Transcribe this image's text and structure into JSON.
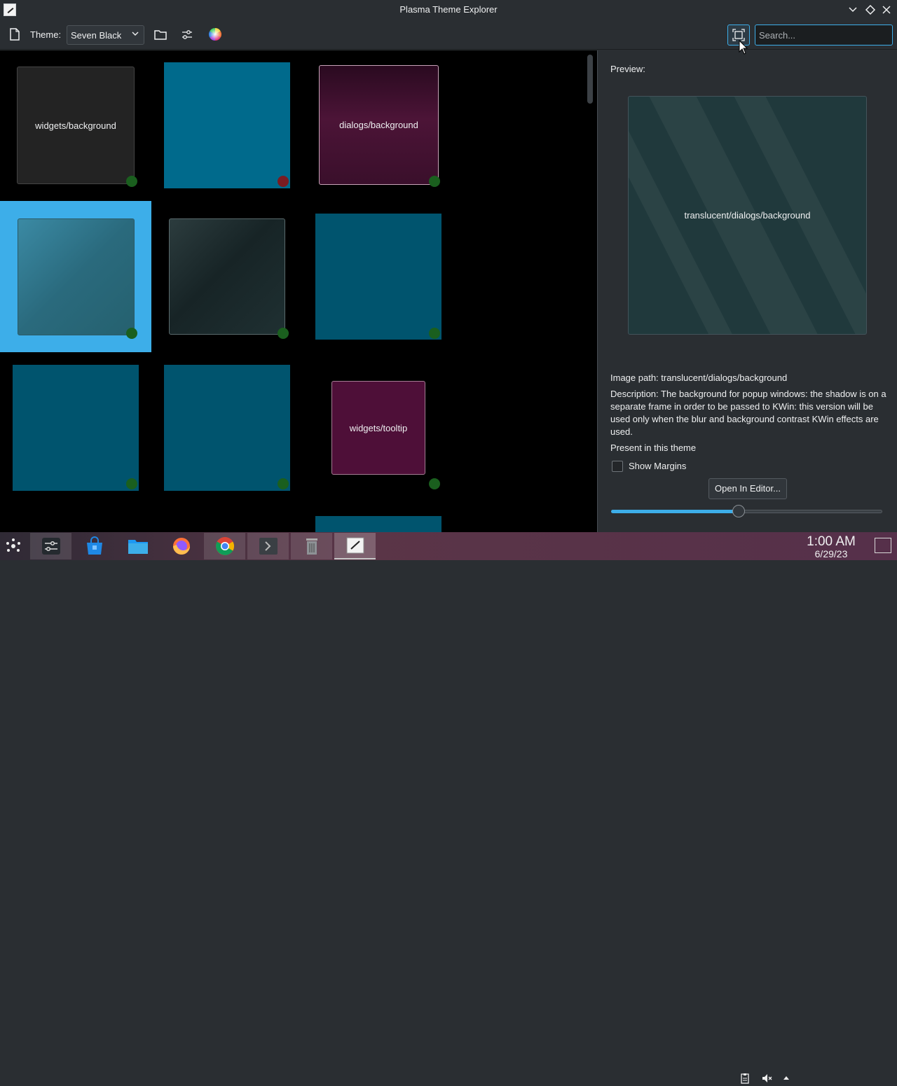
{
  "window": {
    "title": "Plasma Theme Explorer",
    "controls": [
      "minimize-icon",
      "maximize-icon",
      "close-icon"
    ]
  },
  "toolbar": {
    "theme_label": "Theme:",
    "theme_value": "Seven Black",
    "search_placeholder": "Search..."
  },
  "grid": {
    "tiles": [
      {
        "label": "widgets/background",
        "color": "#232323",
        "status": "present"
      },
      {
        "label": "",
        "color": "#006a8c",
        "status": "missing"
      },
      {
        "label": "dialogs/background",
        "color": "#3a0f2b",
        "status": "present"
      },
      {
        "label": "",
        "color": "#2a6a7d",
        "status": "present",
        "selected": true
      },
      {
        "label": "",
        "color": "#1c2c2e",
        "status": "present"
      },
      {
        "label": "",
        "color": "#00546e",
        "status": "present"
      },
      {
        "label": "",
        "color": "#00546e",
        "status": "present"
      },
      {
        "label": "",
        "color": "#00546e",
        "status": "present"
      },
      {
        "label": "widgets/tooltip",
        "color": "#4e0f38",
        "status": "present"
      }
    ]
  },
  "preview": {
    "heading": "Preview:",
    "element_name": "translucent/dialogs/background",
    "image_path_line": "Image path: translucent/dialogs/background",
    "description_line": "Description: The background for popup windows: the shadow is on a separate frame in order to be passed to KWin: this version will be used only when the blur and background contrast KWin effects are used.",
    "present_line": "Present in this theme",
    "show_margins_label": "Show Margins",
    "show_margins_checked": false,
    "open_editor_label": "Open In Editor...",
    "zoom_fraction": 0.47
  },
  "taskbar": {
    "apps": [
      "app-launcher-icon",
      "system-settings-icon",
      "discover-icon",
      "dolphin-icon",
      "firefox-icon",
      "chrome-icon",
      "konsole-icon",
      "trash-icon",
      "plasma-theme-explorer-icon"
    ],
    "time": "1:00 AM",
    "date": "6/29/23"
  },
  "colors": {
    "accent": "#3daee9",
    "present_dot": "#1a5f1e",
    "missing_dot": "#7a1c22"
  }
}
